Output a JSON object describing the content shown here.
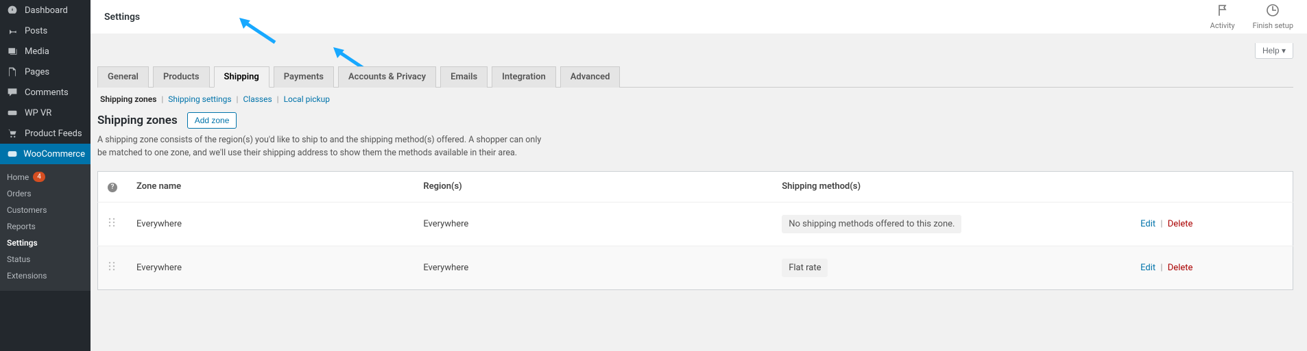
{
  "sidebar": {
    "items": [
      {
        "label": "Dashboard",
        "icon": "speedometer-icon"
      },
      {
        "label": "Posts",
        "icon": "pin-icon"
      },
      {
        "label": "Media",
        "icon": "media-icon"
      },
      {
        "label": "Pages",
        "icon": "pages-icon"
      },
      {
        "label": "Comments",
        "icon": "comment-icon"
      },
      {
        "label": "WP VR",
        "icon": "vr-icon"
      },
      {
        "label": "Product Feeds",
        "icon": "cart-icon"
      },
      {
        "label": "WooCommerce",
        "icon": "woo-icon",
        "current": true
      }
    ],
    "submenu": [
      {
        "label": "Home",
        "badge": "4"
      },
      {
        "label": "Orders"
      },
      {
        "label": "Customers"
      },
      {
        "label": "Reports"
      },
      {
        "label": "Settings",
        "current": true
      },
      {
        "label": "Status"
      },
      {
        "label": "Extensions"
      }
    ]
  },
  "topbar": {
    "page_title": "Settings",
    "activity_label": "Activity",
    "finish_label": "Finish setup"
  },
  "help_button": "Help ▾",
  "tabs": [
    {
      "label": "General"
    },
    {
      "label": "Products"
    },
    {
      "label": "Shipping",
      "active": true
    },
    {
      "label": "Payments"
    },
    {
      "label": "Accounts & Privacy"
    },
    {
      "label": "Emails"
    },
    {
      "label": "Integration"
    },
    {
      "label": "Advanced"
    }
  ],
  "subnav": {
    "current": "Shipping zones",
    "links": [
      "Shipping settings",
      "Classes",
      "Local pickup"
    ]
  },
  "section": {
    "heading": "Shipping zones",
    "add_button": "Add zone",
    "desc": "A shipping zone consists of the region(s) you'd like to ship to and the shipping method(s) offered. A shopper can only be matched to one zone, and we'll use their shipping address to show them the methods available in their area."
  },
  "table": {
    "columns": {
      "zone": "Zone name",
      "region": "Region(s)",
      "method": "Shipping method(s)"
    },
    "row_actions": {
      "edit": "Edit",
      "delete": "Delete"
    },
    "rows": [
      {
        "name": "Everywhere",
        "region": "Everywhere",
        "method": "No shipping methods offered to this zone."
      },
      {
        "name": "Everywhere",
        "region": "Everywhere",
        "method": "Flat rate"
      }
    ]
  }
}
